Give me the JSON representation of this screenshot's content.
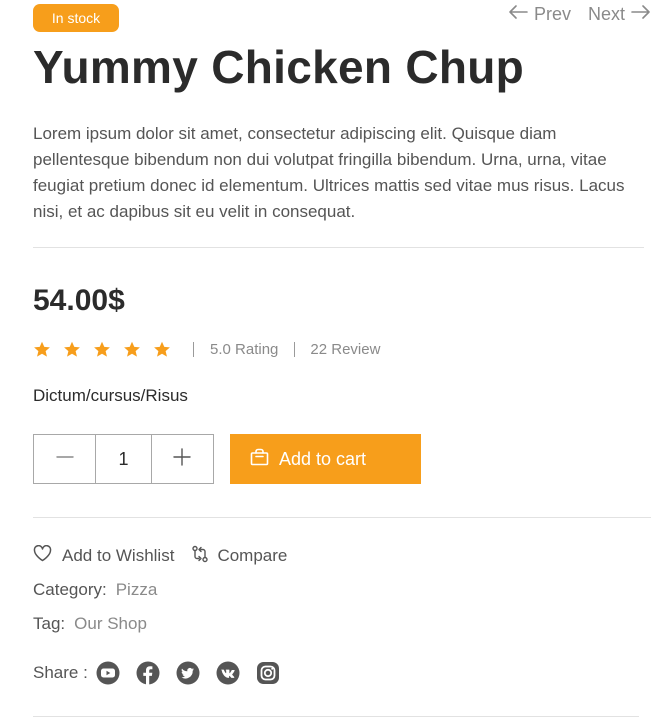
{
  "badge": {
    "label": "In stock",
    "color": "#f79e1b"
  },
  "nav": {
    "prev_label": "Prev",
    "next_label": "Next",
    "prev_icon": "arrow-left-icon",
    "next_icon": "arrow-right-icon"
  },
  "product": {
    "title": "Yummy Chicken Chup",
    "description": "Lorem ipsum dolor sit amet, consectetur adipiscing elit. Quisque diam pellentesque bibendum non dui volutpat fringilla bibendum. Urna, urna, vitae feugiat pretium donec id elementum. Ultrices mattis sed vitae mus risus. Lacus nisi, et ac dapibus sit eu velit in consequat.",
    "price": "54.00$",
    "stars": 5,
    "rating_text": "5.0 Rating",
    "review_text": "22 Review",
    "variant": "Dictum/cursus/Risus"
  },
  "quantity": {
    "value": "1",
    "minus_icon": "minus-icon",
    "plus_icon": "plus-icon"
  },
  "cart": {
    "label": "Add to cart",
    "icon": "shopping-bag-icon",
    "color": "#f79e1b"
  },
  "actions": {
    "wishlist_label": "Add to Wishlist",
    "wishlist_icon": "heart-icon",
    "compare_label": "Compare",
    "compare_icon": "compare-icon"
  },
  "meta": {
    "category_label": "Category:",
    "category_value": "Pizza",
    "tag_label": "Tag:",
    "tag_value": "Our Shop"
  },
  "share": {
    "label": "Share :",
    "icons": [
      "youtube-icon",
      "facebook-icon",
      "twitter-icon",
      "vk-icon",
      "instagram-icon"
    ]
  },
  "colors": {
    "accent": "#f79e1b",
    "star": "#f79e1b",
    "text": "#2b2b2b",
    "muted": "#8a8a8a"
  }
}
